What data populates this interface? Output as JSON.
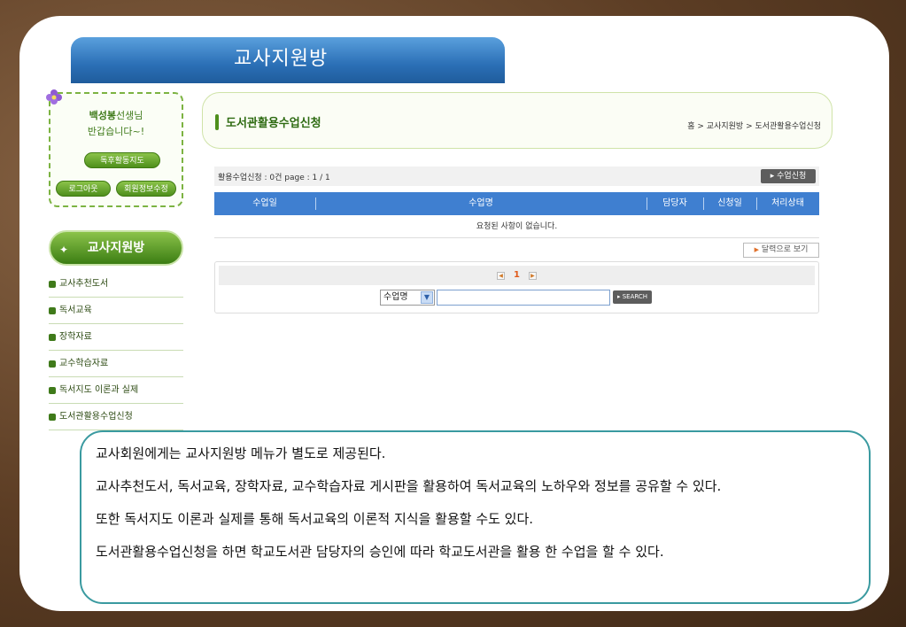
{
  "header": {
    "title": "교사지원방"
  },
  "login": {
    "user_name": "백성봉",
    "user_suffix": "선생님",
    "greeting": "반갑습니다~!",
    "reading_button": "독후활동지도",
    "logout_button": "로그아웃",
    "edit_profile_button": "회원정보수정"
  },
  "sidebar": {
    "heading": "교사지원방",
    "items": [
      {
        "label": "교사추천도서"
      },
      {
        "label": "독서교육"
      },
      {
        "label": "장학자료"
      },
      {
        "label": "교수학습자료"
      },
      {
        "label": "독서지도 이론과 실제"
      },
      {
        "label": "도서관활용수업신청"
      }
    ]
  },
  "main": {
    "page_title": "도서관활용수업신청",
    "breadcrumb": "홈 > 교사지원방 > 도서관활용수업신청",
    "count_text": "활용수업신청 : 0건   page : 1 / 1",
    "apply_button": "▸ 수업신청",
    "columns": [
      "수업일",
      "수업명",
      "담당자",
      "신청일",
      "처리상태"
    ],
    "empty_message": "요청된 사항이 없습니다.",
    "calendar_button": "달력으로 보기",
    "pager": {
      "current": "1"
    },
    "search": {
      "select_value": "수업명",
      "input_value": "",
      "button_label": "▸ SEARCH"
    }
  },
  "note": {
    "lines": [
      "교사회원에게는 교사지원방 메뉴가 별도로 제공된다.",
      "교사추천도서, 독서교육, 장학자료, 교수학습자료 게시판을 활용하여 독서교육의 노하우와 정보를 공유할 수 있다.",
      "또한 독서지도 이론과 실제를 통해 독서교육의 이론적 지식을 활용할 수도 있다.",
      "도서관활용수업신청을 하면 학교도서관 담당자의 승인에 따라 학교도서관을 활용 한 수업을 할 수 있다."
    ]
  }
}
